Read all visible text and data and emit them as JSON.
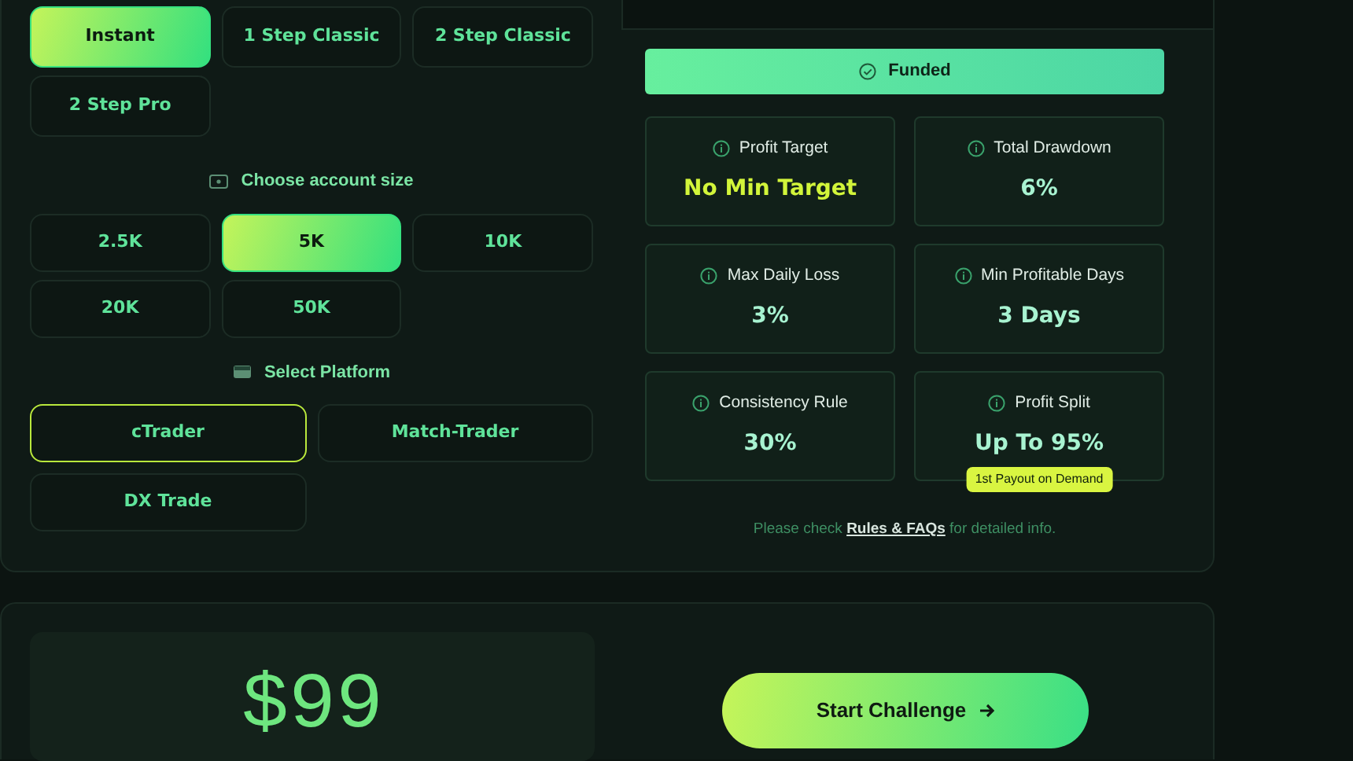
{
  "challenge_types": [
    {
      "label": "Instant",
      "selected": true
    },
    {
      "label": "1 Step Classic",
      "selected": false
    },
    {
      "label": "2 Step Classic",
      "selected": false
    },
    {
      "label": "2 Step Pro",
      "selected": false
    }
  ],
  "account_size": {
    "heading": "Choose account size",
    "options": [
      {
        "label": "2.5K",
        "selected": false
      },
      {
        "label": "5K",
        "selected": true
      },
      {
        "label": "10K",
        "selected": false
      },
      {
        "label": "20K",
        "selected": false
      },
      {
        "label": "50K",
        "selected": false
      }
    ]
  },
  "platform": {
    "heading": "Select Platform",
    "options": [
      {
        "label": "cTrader",
        "selected": true
      },
      {
        "label": "Match-Trader",
        "selected": false
      },
      {
        "label": "DX Trade",
        "selected": false
      }
    ]
  },
  "phase": {
    "label": "Funded"
  },
  "rules": [
    {
      "title": "Profit Target",
      "value": "No Min Target",
      "highlighted": true
    },
    {
      "title": "Total Drawdown",
      "value": "6%",
      "highlighted": false
    },
    {
      "title": "Max Daily Loss",
      "value": "3%",
      "highlighted": false
    },
    {
      "title": "Min Profitable Days",
      "value": "3 Days",
      "highlighted": false
    },
    {
      "title": "Consistency Rule",
      "value": "30%",
      "highlighted": false
    },
    {
      "title": "Profit Split",
      "value": "Up To 95%",
      "highlighted": false,
      "badge": "1st Payout on Demand"
    }
  ],
  "note": {
    "before": "Please check",
    "link": "Rules & FAQs",
    "after": "for detailed info."
  },
  "price": "$99",
  "start_button": {
    "label": "Start Challenge"
  }
}
